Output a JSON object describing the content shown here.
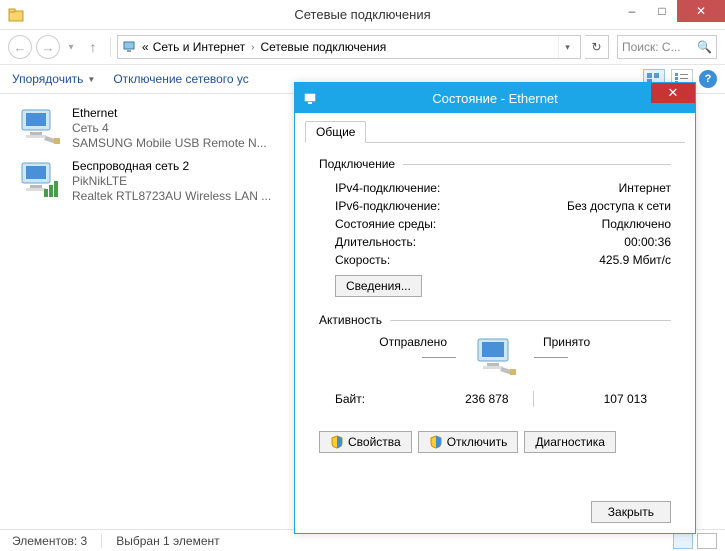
{
  "window": {
    "title": "Сетевые подключения",
    "minimize": "–",
    "maximize": "□",
    "close": "✕"
  },
  "nav": {
    "back_icon": "←",
    "fwd_icon": "→",
    "up_icon": "↑",
    "caret": "▾",
    "breadcrumb_prefix": "«",
    "crumb1": "Сеть и Интернет",
    "crumb2": "Сетевые подключения",
    "arrow": "›",
    "dd": "▾",
    "refresh": "↻"
  },
  "search": {
    "placeholder": "Поиск: С...",
    "icon": "🔍"
  },
  "toolbar": {
    "organize": "Упорядочить",
    "organize_caret": "▼",
    "disable": "Отключение сетевого ус",
    "help": "?"
  },
  "connections": [
    {
      "name": "Ethernet",
      "status": "Сеть  4",
      "device": "SAMSUNG Mobile USB Remote N..."
    },
    {
      "name": "Беспроводная сеть 2",
      "status": "PikNikLTE",
      "device": "Realtek RTL8723AU Wireless LAN ..."
    }
  ],
  "statusbar": {
    "count": "Элементов: 3",
    "selected": "Выбран 1 элемент"
  },
  "dialog": {
    "title": "Состояние - Ethernet",
    "close": "✕",
    "tab_general": "Общие",
    "group_connection": "Подключение",
    "ipv4_k": "IPv4-подключение:",
    "ipv4_v": "Интернет",
    "ipv6_k": "IPv6-подключение:",
    "ipv6_v": "Без доступа к сети",
    "media_k": "Состояние среды:",
    "media_v": "Подключено",
    "duration_k": "Длительность:",
    "duration_v": "00:00:36",
    "speed_k": "Скорость:",
    "speed_v": "425.9 Мбит/с",
    "details_btn": "Сведения...",
    "group_activity": "Активность",
    "sent_lbl": "Отправлено",
    "recv_lbl": "Принято",
    "bytes_lbl": "Байт:",
    "bytes_sent": "236 878",
    "bytes_recv": "107 013",
    "props_btn": "Свойства",
    "disable_btn": "Отключить",
    "diag_btn": "Диагностика",
    "close_btn": "Закрыть"
  }
}
